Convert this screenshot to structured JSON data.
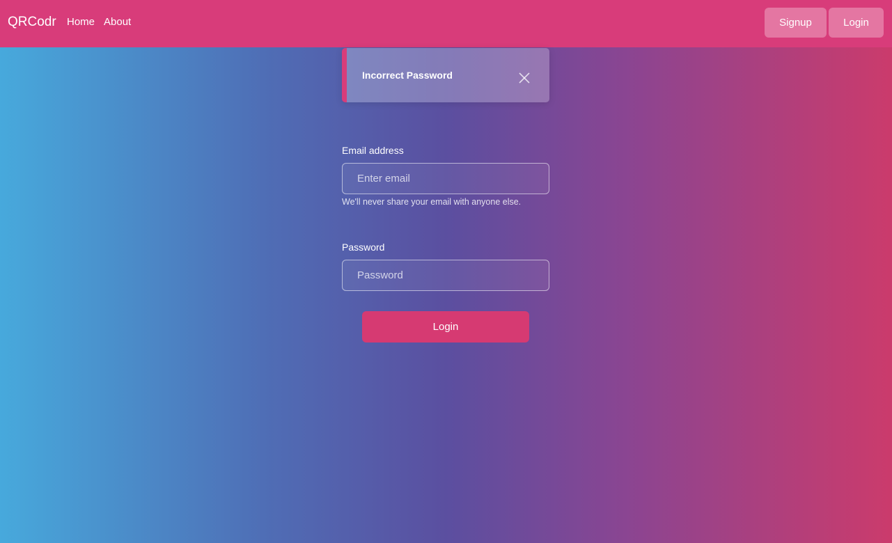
{
  "navbar": {
    "brand": "QRCodr",
    "links": [
      {
        "label": "Home"
      },
      {
        "label": "About"
      }
    ],
    "signup_label": "Signup",
    "login_label": "Login",
    "background_color": "#d83c7a"
  },
  "toast": {
    "message": "Incorrect Password",
    "accent_color": "#d83c7a",
    "close_icon": "close-icon"
  },
  "form": {
    "email": {
      "label": "Email address",
      "placeholder": "Enter email",
      "value": "",
      "help_text": "We'll never share your email with anyone else."
    },
    "password": {
      "label": "Password",
      "placeholder": "Password",
      "value": ""
    },
    "submit_label": "Login",
    "submit_color": "#d63a72"
  }
}
